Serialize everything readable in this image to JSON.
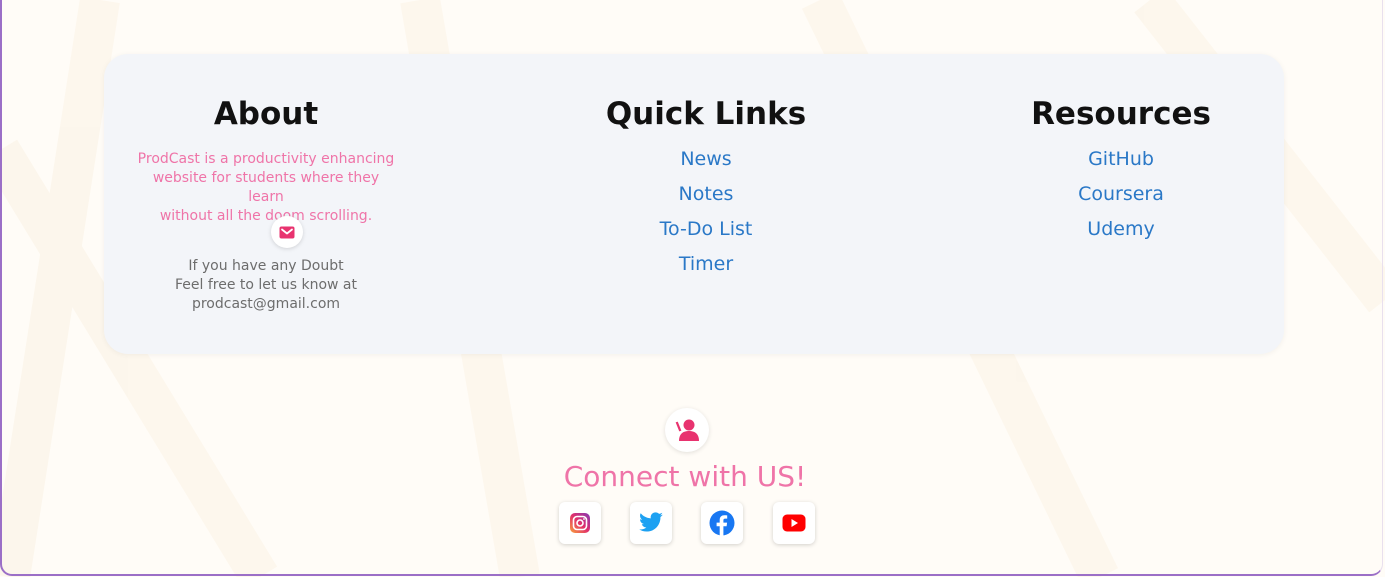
{
  "about": {
    "title": "About",
    "description_lines": [
      "ProdCast is a productivity enhancing",
      "website for students where they learn",
      "without all the doom scrolling."
    ],
    "mail_icon": "mail-icon",
    "doubt_lines": [
      "If you have any Doubt",
      "Feel free to let us know at",
      "prodcast@gmail.com"
    ]
  },
  "quick_links": {
    "title": "Quick Links",
    "items": [
      "News",
      "Notes",
      "To-Do List",
      "Timer"
    ]
  },
  "resources": {
    "title": "Resources",
    "items": [
      "GitHub",
      "Coursera",
      "Udemy"
    ]
  },
  "connect": {
    "icon": "contact-icon",
    "title": "Connect with US!",
    "social": [
      {
        "name": "instagram-icon",
        "color": "#c13584"
      },
      {
        "name": "twitter-icon",
        "color": "#1da1f2"
      },
      {
        "name": "facebook-icon",
        "color": "#1877f2"
      },
      {
        "name": "youtube-icon",
        "color": "#ff0000"
      }
    ]
  },
  "colors": {
    "accent_pink": "#ef74a8",
    "link_blue": "#2a78c7",
    "panel_bg": "#f3f5f9",
    "page_bg": "#fffcf7"
  }
}
